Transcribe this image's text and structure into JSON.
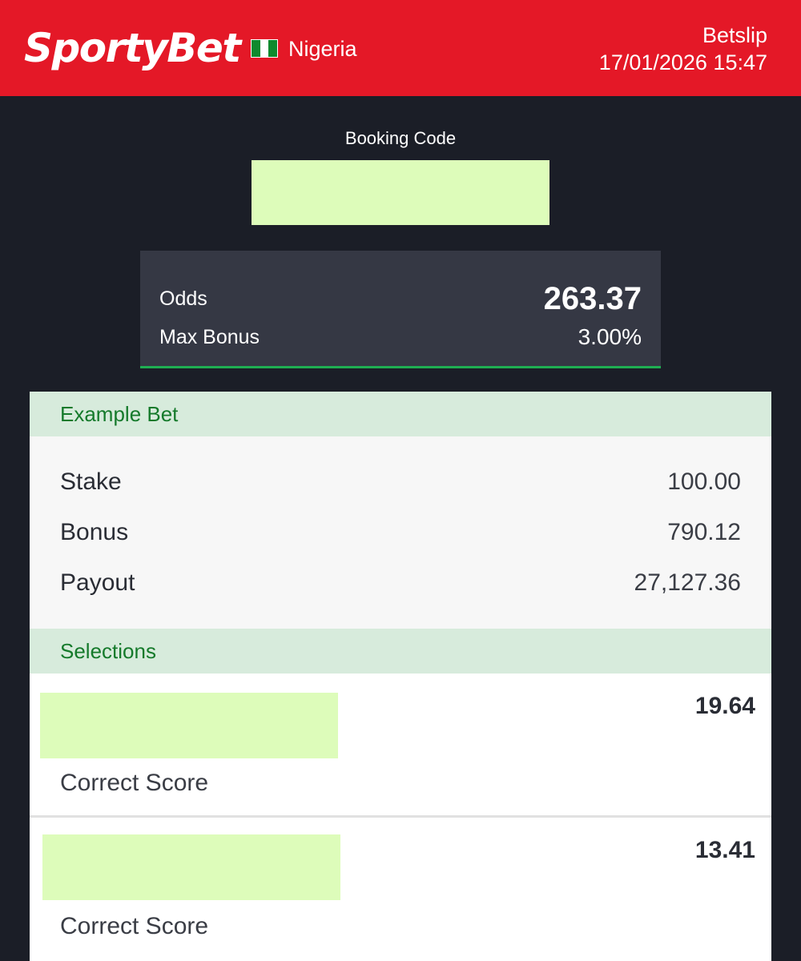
{
  "header": {
    "brand": "SportyBet",
    "country": "Nigeria",
    "title": "Betslip",
    "datetime": "17/01/2026 15:47"
  },
  "booking": {
    "label": "Booking Code"
  },
  "odds": {
    "odds_label": "Odds",
    "odds_value": "263.37",
    "bonus_label": "Max Bonus",
    "bonus_value": "3.00%"
  },
  "example_bet": {
    "heading": "Example Bet",
    "rows": [
      {
        "label": "Stake",
        "value": "100.00"
      },
      {
        "label": "Bonus",
        "value": "790.12"
      },
      {
        "label": "Payout",
        "value": "27,127.36"
      }
    ]
  },
  "selections": {
    "heading": "Selections",
    "items": [
      {
        "odds": "19.64",
        "market": "Correct Score"
      },
      {
        "odds": "13.41",
        "market": "Correct Score"
      }
    ]
  },
  "colors": {
    "brand_red": "#e41827",
    "background": "#1b1e27",
    "accent_green": "#1fae52",
    "section_green_text": "#157a2b",
    "redaction": "#ddfcba"
  }
}
